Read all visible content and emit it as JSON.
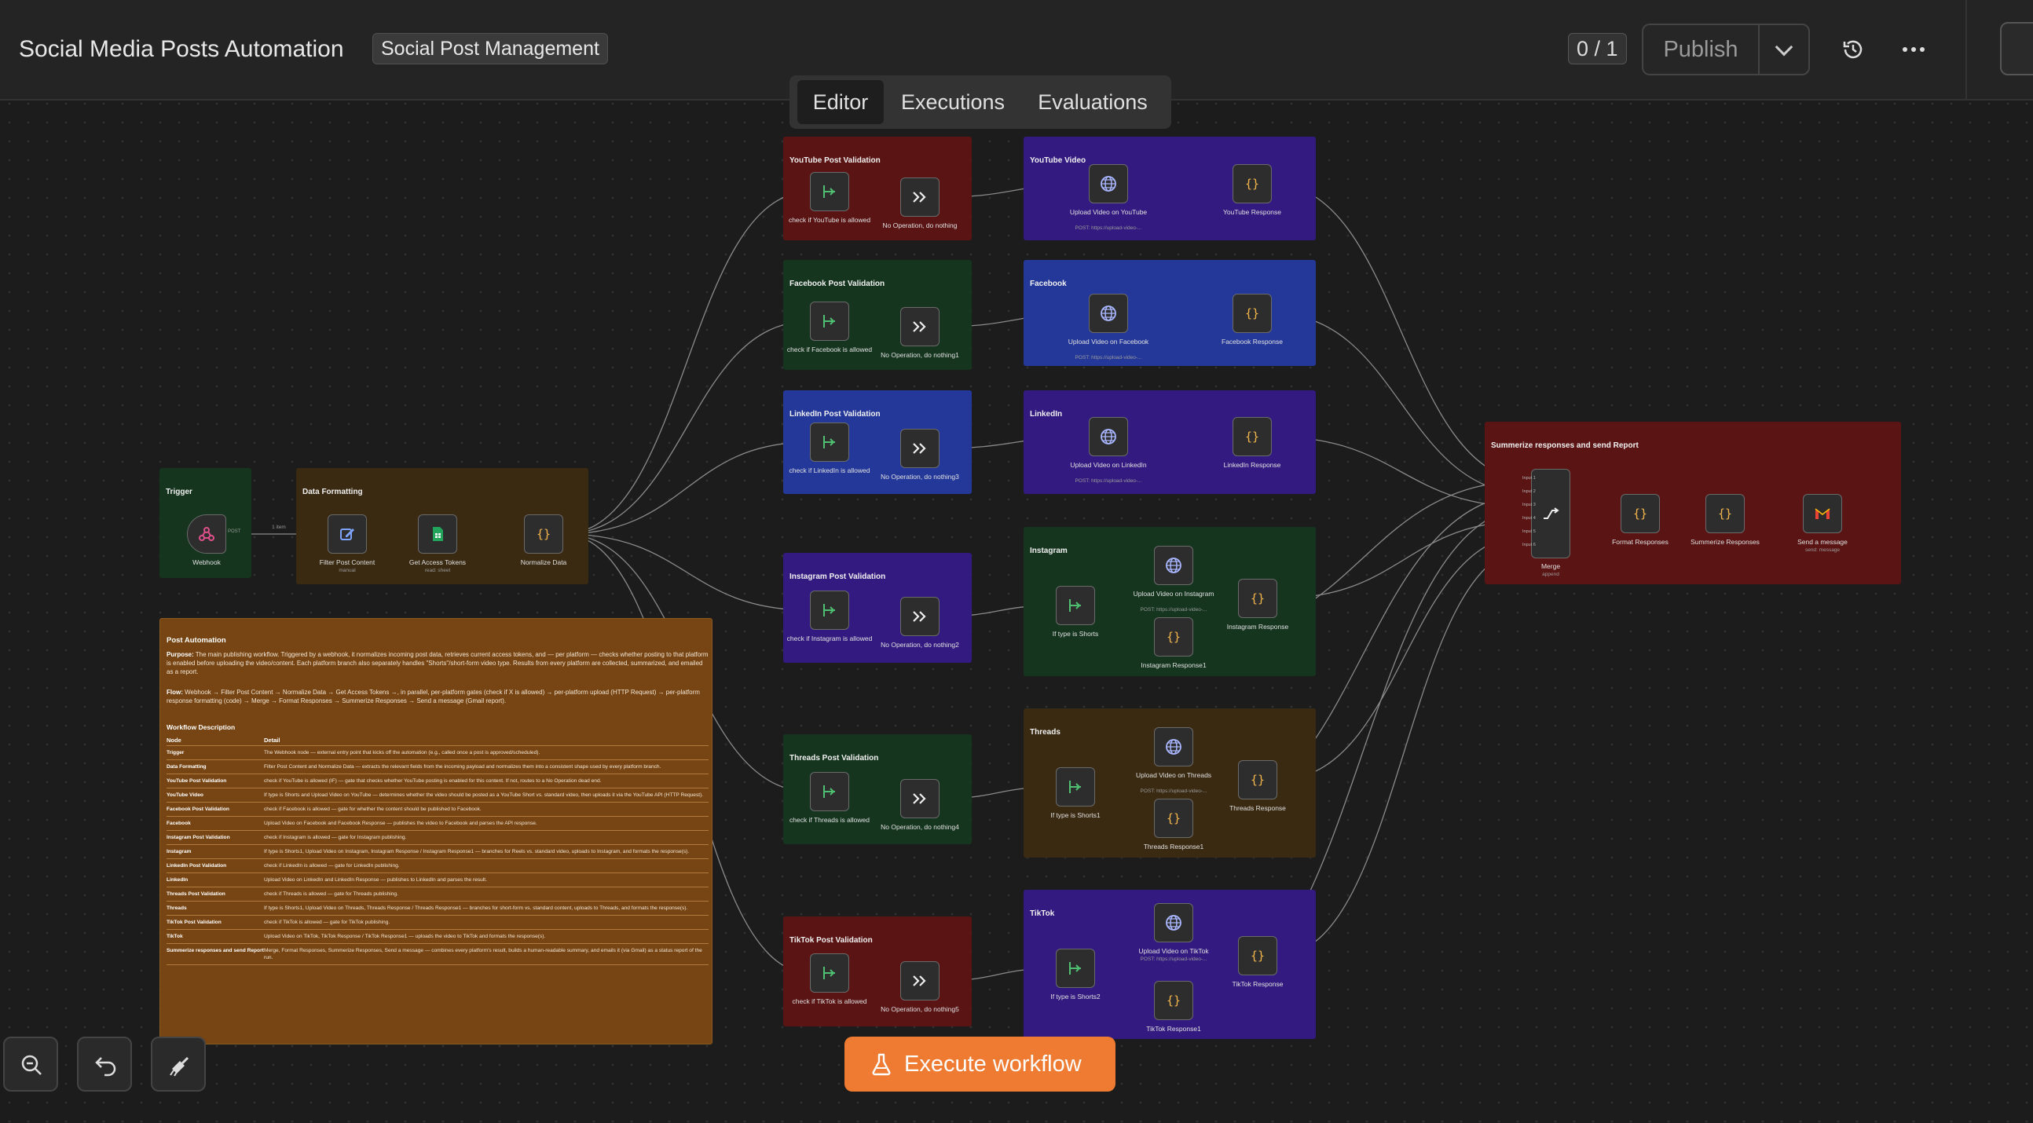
{
  "header": {
    "title": "Social Media Posts Automation",
    "tag": "Social Post Management",
    "counter": "0 / 1",
    "publish": "Publish"
  },
  "tabs": {
    "editor": "Editor",
    "executions": "Executions",
    "evaluations": "Evaluations"
  },
  "groups": {
    "youtube_validation": "YouTube Post Validation",
    "youtube": "YouTube Video",
    "facebook_validation": "Facebook Post Validation",
    "facebook": "Facebook",
    "linkedin_validation": "LinkedIn Post Validation",
    "linkedin": "LinkedIn",
    "instagram_validation": "Instagram Post Validation",
    "instagram": "Instagram",
    "threads_validation": "Threads Post Validation",
    "threads": "Threads",
    "tiktok_validation": "TikTok Post Validation",
    "tiktok": "TikTok",
    "trigger": "Trigger",
    "data_formatting": "Data Formatting",
    "report": "Summerize responses and send Report"
  },
  "nodes": {
    "webhook": "Webhook",
    "webhook_port": "POST",
    "edge_item": "1 item",
    "filter": "Filter Post Content",
    "filter_sub": "manual",
    "tokens": "Get Access Tokens",
    "tokens_sub": "read: sheet",
    "normalize": "Normalize Data",
    "yt_check": "check if YouTube is allowed",
    "yt_noop": "No Operation, do nothing",
    "yt_upload": "Upload Video on YouTube",
    "yt_upload_sub": "POST: https://upload-video-...",
    "yt_resp": "YouTube Response",
    "fb_check": "check if Facebook is allowed",
    "fb_noop": "No Operation, do nothing1",
    "fb_upload": "Upload Video on Facebook",
    "fb_upload_sub": "POST: https://upload-video-...",
    "fb_resp": "Facebook Response",
    "li_check": "check if LinkedIn is allowed",
    "li_noop": "No Operation, do nothing3",
    "li_upload": "Upload Video on LinkedIn",
    "li_upload_sub": "POST: https://upload-video-...",
    "li_resp": "LinkedIn Response",
    "ig_check": "check if Instagram is allowed",
    "ig_noop": "No Operation, do nothing2",
    "ig_if": "If type is Shorts",
    "ig_upload": "Upload Video on Instagram",
    "ig_upload_sub": "POST: https://upload-video-...",
    "ig_resp": "Instagram Response",
    "ig_resp1": "Instagram Response1",
    "th_check": "check if Threads is allowed",
    "th_noop": "No Operation, do nothing4",
    "th_if": "If type is Shorts1",
    "th_upload": "Upload Video on Threads",
    "th_upload_sub": "POST: https://upload-video-...",
    "th_resp": "Threads Response",
    "th_resp1": "Threads Response1",
    "tt_check": "check if TikTok is allowed",
    "tt_noop": "No Operation, do nothing5",
    "tt_if": "If type is Shorts2",
    "tt_upload": "Upload Video on TikTok",
    "tt_upload_sub": "POST: https://upload-video-...",
    "tt_resp": "TikTok Response",
    "tt_resp1": "TikTok Response1",
    "merge": "Merge",
    "merge_sub": "append",
    "format": "Format Responses",
    "summ": "Summerize Responses",
    "send": "Send a message",
    "send_sub": "send: message",
    "merge_inputs": [
      "Input 1",
      "Input 2",
      "Input 3",
      "Input 4",
      "Input 5",
      "Input 6"
    ]
  },
  "note": {
    "title": "Post Automation",
    "purpose_label": "Purpose:",
    "purpose": "The main publishing workflow. Triggered by a webhook, it normalizes incoming post data, retrieves current access tokens, and — per platform — checks whether posting to that platform is enabled before uploading the video/content. Each platform branch also separately handles \"Shorts\"/short-form video type. Results from every platform are collected, summarized, and emailed as a report.",
    "flow_label": "Flow:",
    "flow": "Webhook → Filter Post Content → Normalize Data → Get Access Tokens →, in parallel, per-platform gates (check if X is allowed) → per-platform upload (HTTP Request) → per-platform response formatting (code) → Merge → Format Responses → Summerize Responses → Send a message (Gmail report).",
    "desc_title": "Workflow Description",
    "col_node": "Node",
    "col_detail": "Detail",
    "rows": [
      [
        "Trigger",
        "The Webhook node — external entry point that kicks off the automation (e.g., called once a post is approved/scheduled)."
      ],
      [
        "Data Formatting",
        "Filter Post Content and Normalize Data — extracts the relevant fields from the incoming payload and normalizes them into a consistent shape used by every platform branch."
      ],
      [
        "YouTube Post Validation",
        "check if YouTube is allowed (IF) — gate that checks whether YouTube posting is enabled for this content. If not, routes to a No Operation dead end."
      ],
      [
        "YouTube Video",
        "If type is Shorts and Upload Video on YouTube — determines whether the video should be posted as a YouTube Short vs. standard video, then uploads it via the YouTube API (HTTP Request)."
      ],
      [
        "Facebook Post Validation",
        "check if Facebook is allowed — gate for whether the content should be published to Facebook."
      ],
      [
        "Facebook",
        "Upload Video on Facebook and Facebook Response — publishes the video to Facebook and parses the API response."
      ],
      [
        "Instagram Post Validation",
        "check if Instagram is allowed — gate for Instagram publishing."
      ],
      [
        "Instagram",
        "If type is Shorts1, Upload Video on Instagram, Instagram Response / Instagram Response1 — branches for Reels vs. standard video, uploads to Instagram, and formats the response(s)."
      ],
      [
        "LinkedIn Post Validation",
        "check if LinkedIn is allowed — gate for LinkedIn publishing."
      ],
      [
        "LinkedIn",
        "Upload Video on LinkedIn and LinkedIn Response — publishes to LinkedIn and parses the result."
      ],
      [
        "Threads Post Validation",
        "check if Threads is allowed — gate for Threads publishing."
      ],
      [
        "Threads",
        "If type is Shorts1, Upload Video on Threads, Threads Response / Threads Response1 — branches for short-form vs. standard content, uploads to Threads, and formats the response(s)."
      ],
      [
        "TikTok Post Validation",
        "check if TikTok is allowed — gate for TikTok publishing."
      ],
      [
        "TikTok",
        "Upload Video on TikTok, TikTok Response / TikTok Response1 — uploads the video to TikTok and formats the response(s)."
      ],
      [
        "Summerize responses and send Report",
        "Merge, Format Responses, Summerize Responses, Send a message — combines every platform's result, builds a human-readable summary, and emails it (via Gmail) as a status report of the run."
      ]
    ]
  },
  "footer": {
    "execute": "Execute workflow"
  },
  "colors": {
    "accent": "#ef7b32",
    "red_group": "#5a1414",
    "green_group": "#15351f",
    "blue_group": "#24389a",
    "purple_group": "#331a80",
    "brown_group": "#3a2a12",
    "note": "#774513"
  }
}
